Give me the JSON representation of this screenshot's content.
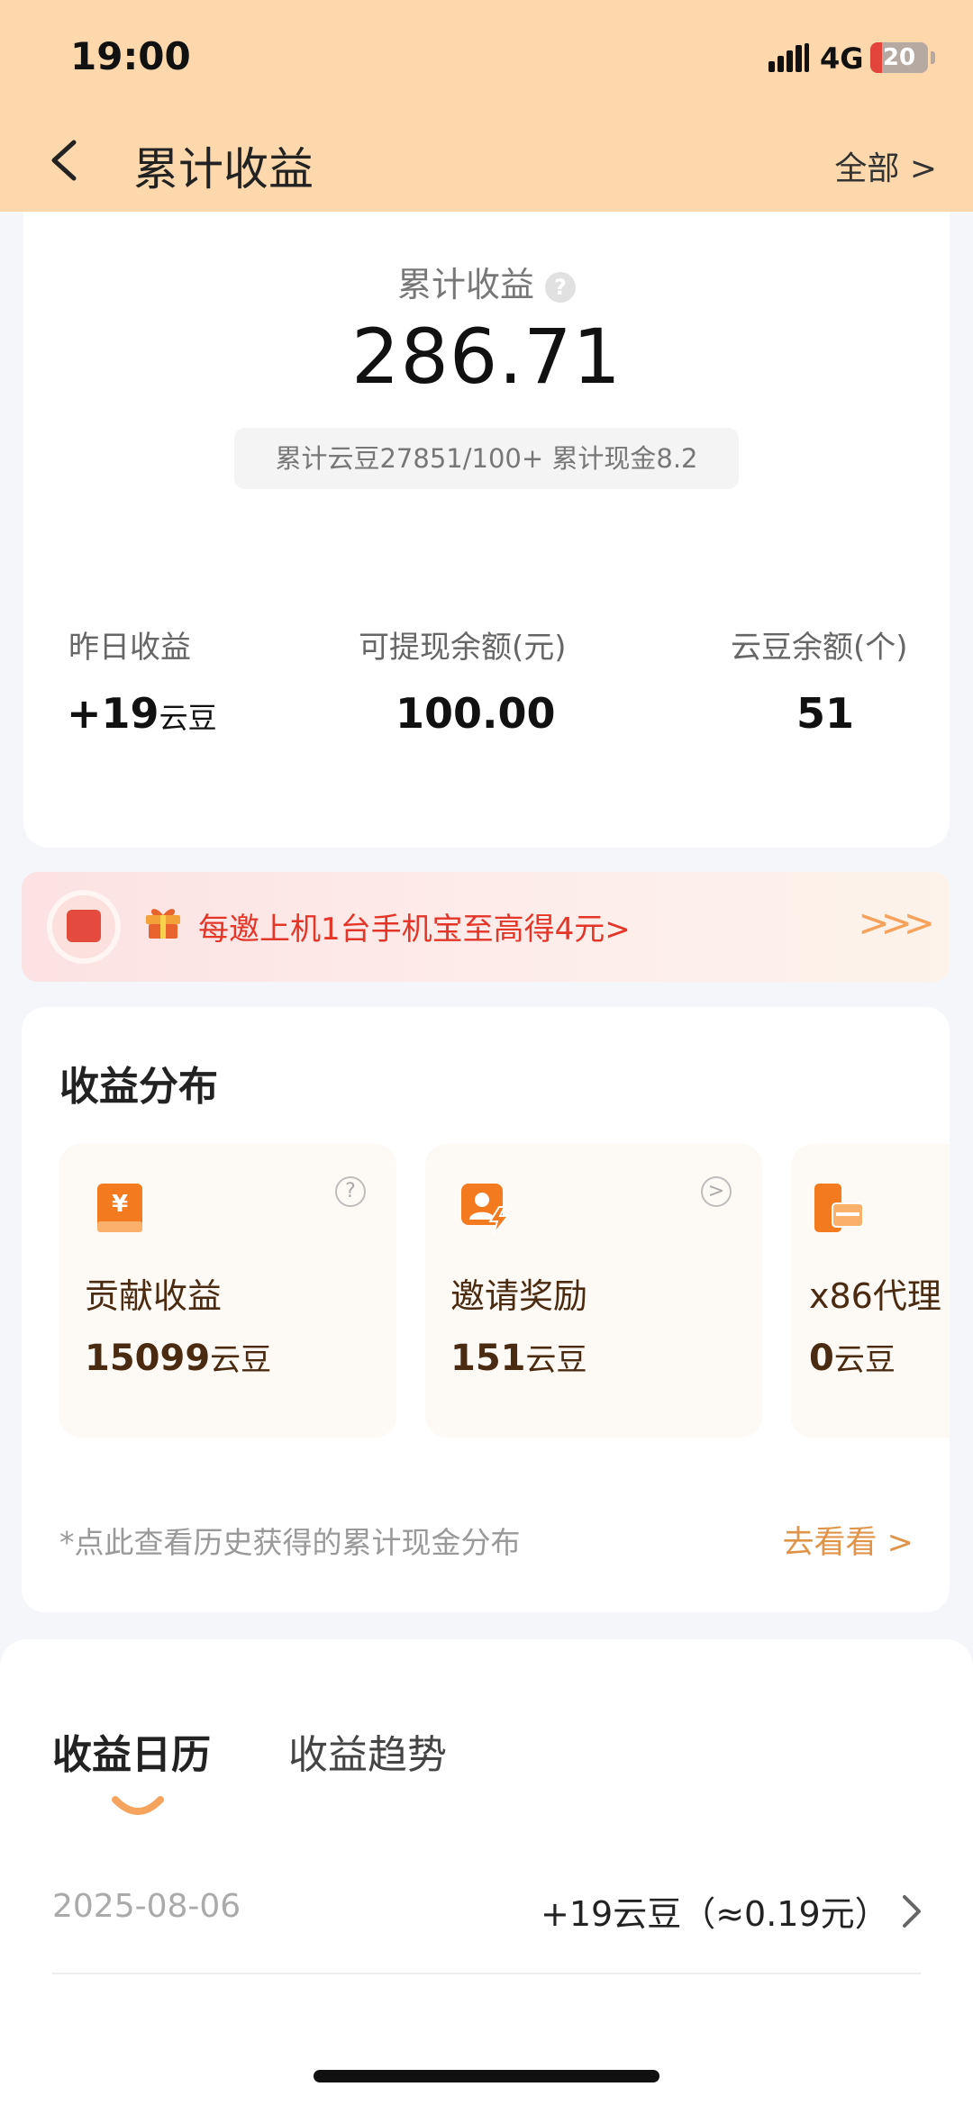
{
  "status_bar": {
    "time": "19:00",
    "network": "4G",
    "battery": "20",
    "battery_level_percent": 20
  },
  "nav": {
    "title": "累计收益",
    "right_link": "全部 >"
  },
  "summary": {
    "label": "累计收益",
    "help_icon": "?",
    "total": "286.71",
    "sub": "累计云豆27851/100+ 累计现金8.2"
  },
  "stats": [
    {
      "label": "昨日收益",
      "value": "+19",
      "unit": "云豆"
    },
    {
      "label": "可提现余额(元)",
      "value": "100.00",
      "unit": ""
    },
    {
      "label": "云豆余额(个)",
      "value": "51",
      "unit": ""
    }
  ],
  "banner": {
    "text": "每邀上机1台手机宝至高得4元>",
    "arrows": ">>>"
  },
  "distribution": {
    "title": "收益分布",
    "items": [
      {
        "name": "贡献收益",
        "value": "15099",
        "unit": "云豆",
        "corner": "?",
        "icon": "ledger-yen-icon"
      },
      {
        "name": "邀请奖励",
        "value": "151",
        "unit": "云豆",
        "corner": ">",
        "icon": "user-lightning-icon"
      },
      {
        "name": "x86代理",
        "value": "0",
        "unit": "云豆",
        "corner": "",
        "icon": "device-card-icon"
      }
    ],
    "note": "*点此查看历史获得的累计现金分布",
    "more": "去看看 >"
  },
  "calendar": {
    "tabs": [
      "收益日历",
      "收益趋势"
    ],
    "active_tab": 0,
    "rows": [
      {
        "date": "2025-08-06",
        "amount": "+19云豆（≈0.19元）"
      }
    ]
  },
  "colors": {
    "header_bg": "#fcd8ac",
    "accent_orange": "#f47a1f",
    "banner_text": "#e33528",
    "link_orange": "#e0944a"
  }
}
